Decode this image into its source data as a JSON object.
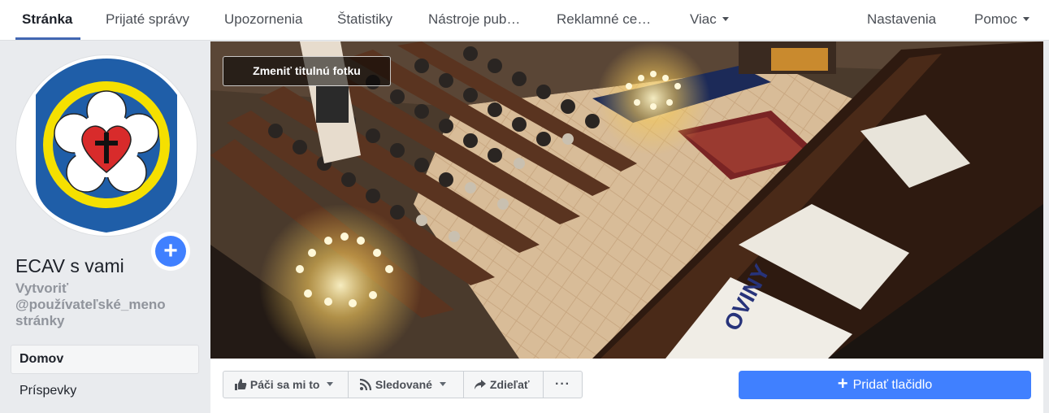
{
  "nav": {
    "items": [
      "Stránka",
      "Prijaté správy",
      "Upozornenia",
      "Štatistiky",
      "Nástroje pub…",
      "Reklamné ce…",
      "Viac"
    ],
    "right": [
      "Nastavenia",
      "Pomoc"
    ]
  },
  "page": {
    "name": "ECAV s vami",
    "username_link": "Vytvoriť @používateľské_meno stránky"
  },
  "sidebar": {
    "items": [
      "Domov",
      "Príspevky"
    ]
  },
  "cover": {
    "change_label": "Zmeniť titulnú fotku",
    "hymnal_text": "OVINY"
  },
  "actions": {
    "like": "Páči sa mi to",
    "follow": "Sledované",
    "share": "Zdieľať",
    "more": "···",
    "add_button": "Pridať tlačidlo"
  },
  "colors": {
    "accent": "#4267b2",
    "button_blue": "#4080ff",
    "logo_blue": "#1f5ea8",
    "logo_yellow": "#f5e000",
    "logo_red": "#d82b2b"
  }
}
